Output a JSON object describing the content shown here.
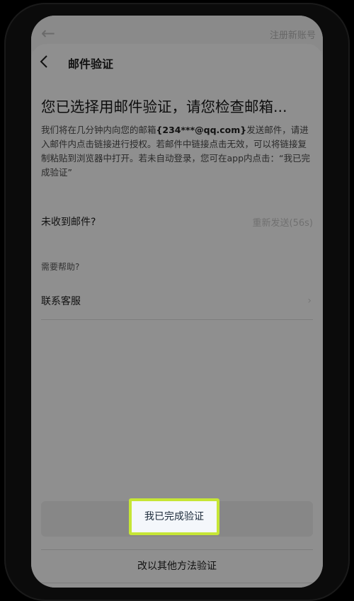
{
  "underlay": {
    "right_text": "注册新账号"
  },
  "header": {
    "title": "邮件验证"
  },
  "main": {
    "title": "您已选择用邮件验证，请您检查邮箱...",
    "desc_part1": "我们将在几分钟内向您的邮箱",
    "email": "{234***@qq.com}",
    "desc_part2": "发送邮件，请进入邮件内点击链接进行授权。若邮件中链接点击无效，可以将链接复制粘贴到浏览器中打开。若未自动登录，您可在app内点击：“我已完成验证”"
  },
  "not_received": {
    "label": "未收到邮件?",
    "resend": "重新发送(56s)"
  },
  "help": {
    "label": "需要帮助?",
    "contact": "联系客服"
  },
  "actions": {
    "done": "我已完成验证",
    "other": "改以其他方法验证"
  },
  "colors": {
    "highlight_border": "#c6e635",
    "overlay": "#8f8f8f"
  }
}
